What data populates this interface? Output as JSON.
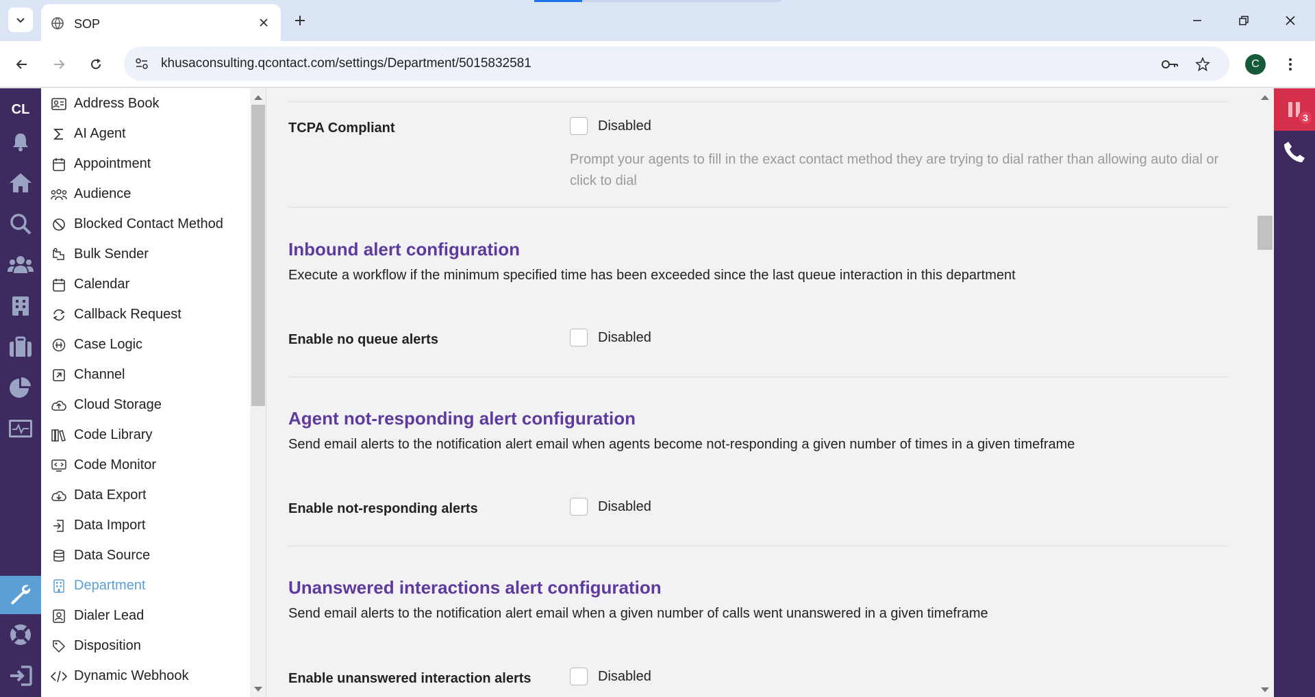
{
  "browser": {
    "tab_title": "SOP",
    "url": "khusaconsulting.qcontact.com/settings/Department/5015832581",
    "profile_initial": "C"
  },
  "rail": {
    "brand": "CL",
    "items": [
      {
        "icon": "bell-icon"
      },
      {
        "icon": "home-icon"
      },
      {
        "icon": "search-icon"
      },
      {
        "icon": "users-icon"
      },
      {
        "icon": "building-icon"
      },
      {
        "icon": "briefcase-icon"
      },
      {
        "icon": "pie-chart-icon"
      },
      {
        "icon": "monitor-icon"
      },
      {
        "icon": "wrench-icon",
        "active": true
      },
      {
        "icon": "lifebuoy-icon"
      },
      {
        "icon": "logout-icon"
      }
    ]
  },
  "settings_list": {
    "items": [
      {
        "label": "Address Book",
        "icon": "address-card-icon"
      },
      {
        "label": "AI Agent",
        "icon": "sigma-icon"
      },
      {
        "label": "Appointment",
        "icon": "calendar-icon"
      },
      {
        "label": "Audience",
        "icon": "audience-icon"
      },
      {
        "label": "Blocked Contact Method",
        "icon": "blocked-icon"
      },
      {
        "label": "Bulk Sender",
        "icon": "bulk-sender-icon"
      },
      {
        "label": "Calendar",
        "icon": "calendar-icon"
      },
      {
        "label": "Callback Request",
        "icon": "refresh-icon"
      },
      {
        "label": "Case Logic",
        "icon": "case-logic-icon"
      },
      {
        "label": "Channel",
        "icon": "external-link-icon"
      },
      {
        "label": "Cloud Storage",
        "icon": "cloud-upload-icon"
      },
      {
        "label": "Code Library",
        "icon": "library-icon"
      },
      {
        "label": "Code Monitor",
        "icon": "code-monitor-icon"
      },
      {
        "label": "Data Export",
        "icon": "cloud-download-icon"
      },
      {
        "label": "Data Import",
        "icon": "import-icon"
      },
      {
        "label": "Data Source",
        "icon": "database-icon"
      },
      {
        "label": "Department",
        "icon": "building-icon",
        "active": true
      },
      {
        "label": "Dialer Lead",
        "icon": "contact-icon"
      },
      {
        "label": "Disposition",
        "icon": "tag-icon"
      },
      {
        "label": "Dynamic Webhook",
        "icon": "code-icon"
      }
    ]
  },
  "main": {
    "tcpa": {
      "label": "TCPA Compliant",
      "checkbox_text": "Disabled",
      "help": "Prompt your agents to fill in the exact contact method they are trying to dial rather than allowing auto dial or click to dial"
    },
    "inbound": {
      "title": "Inbound alert configuration",
      "desc": "Execute a workflow if the minimum specified time has been exceeded since the last queue interaction in this department",
      "field_label": "Enable no queue alerts",
      "checkbox_text": "Disabled"
    },
    "agent": {
      "title": "Agent not-responding alert configuration",
      "desc": "Send email alerts to the notification alert email when agents become not-responding a given number of times in a given timeframe",
      "field_label": "Enable not-responding alerts",
      "checkbox_text": "Disabled"
    },
    "unanswered": {
      "title": "Unanswered interactions alert configuration",
      "desc": "Send email alerts to the notification alert email when a given number of calls went unanswered in a given timeframe",
      "field_label": "Enable unanswered interaction alerts",
      "checkbox_text": "Disabled"
    }
  },
  "right_rail": {
    "alert_count": "3"
  },
  "colors": {
    "rail_bg": "#3d2b5f",
    "active_blue": "#5b9fd4",
    "section_title": "#5d3a9b",
    "alert_red": "#d4304b"
  }
}
